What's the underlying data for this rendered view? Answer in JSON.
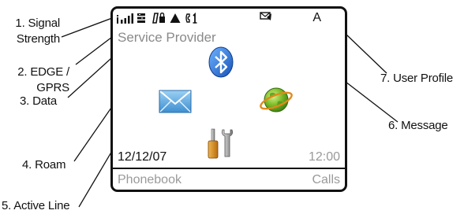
{
  "callouts": [
    {
      "id": "signal",
      "lines": [
        "1. Signal",
        "Strength"
      ]
    },
    {
      "id": "edge",
      "lines": [
        "2. EDGE /",
        "GPRS"
      ]
    },
    {
      "id": "data",
      "lines": [
        "3. Data"
      ]
    },
    {
      "id": "roam",
      "lines": [
        "4. Roam"
      ]
    },
    {
      "id": "active_line",
      "lines": [
        "5. Active Line"
      ]
    },
    {
      "id": "message",
      "lines": [
        "6. Message"
      ]
    },
    {
      "id": "user_profile",
      "lines": [
        "7. User Profile"
      ]
    }
  ],
  "screen": {
    "status_icons": [
      "signal-strength-icon",
      "edge-gprs-icon",
      "data-icon",
      "roam-icon",
      "active-line-icon",
      "message-icon"
    ],
    "user_profile": "A",
    "provider": "Service Provider",
    "apps": [
      "bluetooth-icon",
      "email-icon",
      "browser-icon",
      "settings-tools-icon"
    ],
    "date": "12/12/07",
    "time": "12:00",
    "softkeys": {
      "left": "Phonebook",
      "right": "Calls"
    }
  },
  "colors": {
    "frame": "#111111",
    "dim_text": "#9a9a9a",
    "bluetooth": "#1f6fd0",
    "email": "#4a9ad8",
    "browser": "#6cae2a"
  }
}
